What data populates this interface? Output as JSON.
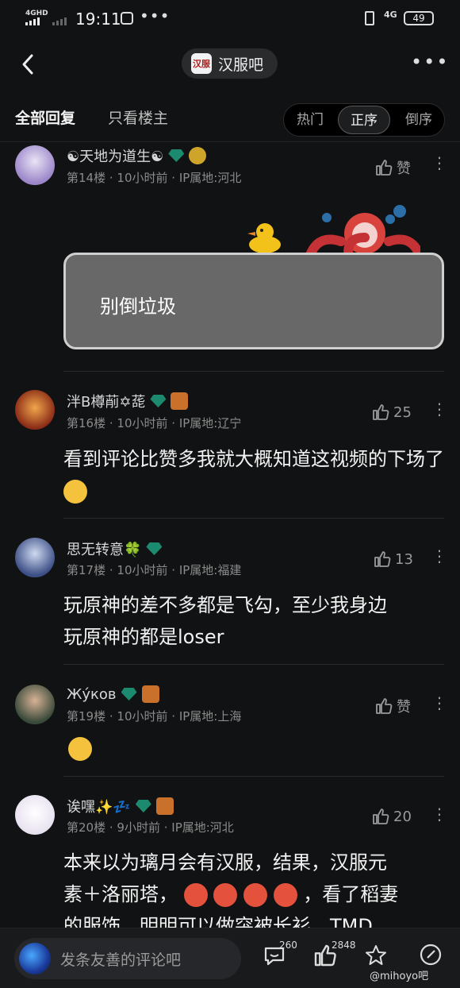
{
  "status_bar": {
    "network": "4GHD",
    "time": "19:11",
    "signal_type": "4G",
    "battery": "49"
  },
  "nav": {
    "forum_name": "汉服吧",
    "logo_text": "汉服"
  },
  "tabs": {
    "all": "全部回复",
    "host_only": "只看楼主"
  },
  "sort": {
    "hot": "热门",
    "asc": "正序",
    "desc": "倒序"
  },
  "comments": [
    {
      "name": "☯天地为道生☯",
      "floor": "第14楼",
      "time": "10小时前",
      "ip": "IP属地:河北",
      "likes": "赞",
      "sticker_text": "别倒垃圾"
    },
    {
      "name": "泮B樽萷✡蒊",
      "floor": "第16楼",
      "time": "10小时前",
      "ip": "IP属地:辽宁",
      "likes": "25",
      "text": "看到评论比赞多我就大概知道这视频的下场了"
    },
    {
      "name": "思无转意🍀",
      "floor": "第17楼",
      "time": "10小时前",
      "ip": "IP属地:福建",
      "likes": "13",
      "text_line1": "玩原神的差不多都是飞勾，至少我身边",
      "text_line2": "玩原神的都是loser"
    },
    {
      "name": "Жýков",
      "floor": "第19楼",
      "time": "10小时前",
      "ip": "IP属地:上海",
      "likes": "赞"
    },
    {
      "name": "诶嘿✨💤",
      "floor": "第20楼",
      "time": "9小时前",
      "ip": "IP属地:河北",
      "likes": "20",
      "text_line1": "本来以为璃月会有汉服，结果，汉服元",
      "text_line2a": "素＋洛丽塔，",
      "text_line2b": "，看了稻妻",
      "text_line3": "的服饰，明明可以做突被长衫，TMD"
    }
  ],
  "bottom": {
    "placeholder": "发条友善的评论吧",
    "comment_count": "260",
    "like_count": "2848",
    "watermark": "@mihoyo吧"
  },
  "colors": {
    "background": "#111213",
    "accent_gem": "#1c8a6f"
  }
}
